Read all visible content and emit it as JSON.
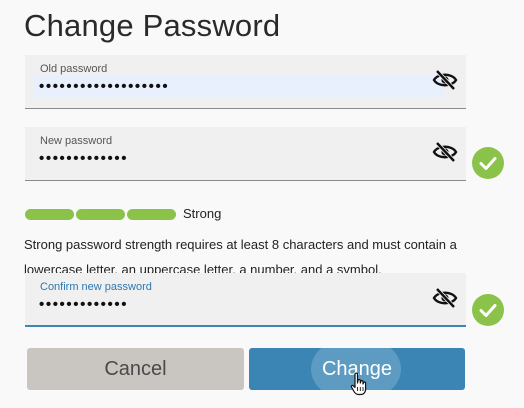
{
  "title": "Change Password",
  "fields": {
    "old": {
      "label": "Old password",
      "value": "•••••••••••••••••••"
    },
    "new": {
      "label": "New password",
      "value": "•••••••••••••"
    },
    "confirm": {
      "label": "Confirm new password",
      "value": "•••••••••••••"
    }
  },
  "strength": {
    "label": "Strong",
    "level": 1.0,
    "color": "#8bc34a"
  },
  "hint": "Strong password strength requires at least 8 characters and must contain a lowercase letter, an uppercase letter, a number, and a symbol.",
  "buttons": {
    "cancel": "Cancel",
    "change": "Change"
  },
  "colors": {
    "accent": "#3b85b5",
    "success": "#8bc34a",
    "cancel_bg": "#c9c6c2"
  },
  "icons": {
    "visibility": "eye-slash-icon",
    "valid": "check-circle-icon",
    "cursor": "hand-pointer-icon"
  }
}
